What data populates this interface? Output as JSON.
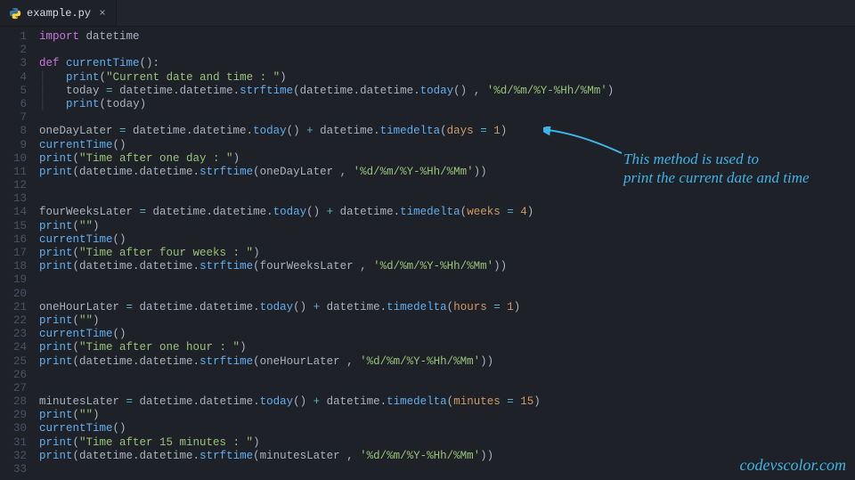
{
  "tab": {
    "filename": "example.py",
    "close_glyph": "×"
  },
  "lines": [
    {
      "n": 1,
      "html": "<span class='kw'>import</span> <span class='mod'>datetime</span>"
    },
    {
      "n": 2,
      "html": ""
    },
    {
      "n": 3,
      "html": "<span class='kw'>def</span> <span class='fn'>currentTime</span><span class='punc'>():</span>"
    },
    {
      "n": 4,
      "html": "<span class='indent-guide'>│</span>   <span class='call'>print</span><span class='punc'>(</span><span class='str'>\"Current date and time : \"</span><span class='punc'>)</span>"
    },
    {
      "n": 5,
      "html": "<span class='indent-guide'>│</span>   <span class='mod'>today </span><span class='op'>=</span><span class='mod'> datetime.datetime.</span><span class='call'>strftime</span><span class='punc'>(</span><span class='mod'>datetime.datetime.</span><span class='call'>today</span><span class='punc'>()</span><span class='mod'> , </span><span class='str'>'%d/%m/%Y-%Hh/%Mm'</span><span class='punc'>)</span>"
    },
    {
      "n": 6,
      "html": "<span class='indent-guide'>│</span>   <span class='call'>print</span><span class='punc'>(</span><span class='mod'>today</span><span class='punc'>)</span>"
    },
    {
      "n": 7,
      "html": ""
    },
    {
      "n": 8,
      "html": "<span class='mod'>oneDayLater </span><span class='op'>=</span><span class='mod'> datetime.datetime.</span><span class='call'>today</span><span class='punc'>()</span><span class='mod'> </span><span class='op'>+</span><span class='mod'> datetime.</span><span class='call'>timedelta</span><span class='punc'>(</span><span class='param'>days</span><span class='mod'> </span><span class='op'>=</span><span class='mod'> </span><span class='num'>1</span><span class='punc'>)</span>"
    },
    {
      "n": 9,
      "html": "<span class='call'>currentTime</span><span class='punc'>()</span>"
    },
    {
      "n": 10,
      "html": "<span class='call'>print</span><span class='punc'>(</span><span class='str'>\"Time after one day : \"</span><span class='punc'>)</span>"
    },
    {
      "n": 11,
      "html": "<span class='call'>print</span><span class='punc'>(</span><span class='mod'>datetime.datetime.</span><span class='call'>strftime</span><span class='punc'>(</span><span class='mod'>oneDayLater , </span><span class='str'>'%d/%m/%Y-%Hh/%Mm'</span><span class='punc'>))</span>"
    },
    {
      "n": 12,
      "html": ""
    },
    {
      "n": 13,
      "html": ""
    },
    {
      "n": 14,
      "html": "<span class='mod'>fourWeeksLater </span><span class='op'>=</span><span class='mod'> datetime.datetime.</span><span class='call'>today</span><span class='punc'>()</span><span class='mod'> </span><span class='op'>+</span><span class='mod'> datetime.</span><span class='call'>timedelta</span><span class='punc'>(</span><span class='param'>weeks</span><span class='mod'> </span><span class='op'>=</span><span class='mod'> </span><span class='num'>4</span><span class='punc'>)</span>"
    },
    {
      "n": 15,
      "html": "<span class='call'>print</span><span class='punc'>(</span><span class='str'>\"\"</span><span class='punc'>)</span>"
    },
    {
      "n": 16,
      "html": "<span class='call'>currentTime</span><span class='punc'>()</span>"
    },
    {
      "n": 17,
      "html": "<span class='call'>print</span><span class='punc'>(</span><span class='str'>\"Time after four weeks : \"</span><span class='punc'>)</span>"
    },
    {
      "n": 18,
      "html": "<span class='call'>print</span><span class='punc'>(</span><span class='mod'>datetime.datetime.</span><span class='call'>strftime</span><span class='punc'>(</span><span class='mod'>fourWeeksLater , </span><span class='str'>'%d/%m/%Y-%Hh/%Mm'</span><span class='punc'>))</span>"
    },
    {
      "n": 19,
      "html": ""
    },
    {
      "n": 20,
      "html": ""
    },
    {
      "n": 21,
      "html": "<span class='mod'>oneHourLater </span><span class='op'>=</span><span class='mod'> datetime.datetime.</span><span class='call'>today</span><span class='punc'>()</span><span class='mod'> </span><span class='op'>+</span><span class='mod'> datetime.</span><span class='call'>timedelta</span><span class='punc'>(</span><span class='param'>hours</span><span class='mod'> </span><span class='op'>=</span><span class='mod'> </span><span class='num'>1</span><span class='punc'>)</span>"
    },
    {
      "n": 22,
      "html": "<span class='call'>print</span><span class='punc'>(</span><span class='str'>\"\"</span><span class='punc'>)</span>"
    },
    {
      "n": 23,
      "html": "<span class='call'>currentTime</span><span class='punc'>()</span>"
    },
    {
      "n": 24,
      "html": "<span class='call'>print</span><span class='punc'>(</span><span class='str'>\"Time after one hour : \"</span><span class='punc'>)</span>"
    },
    {
      "n": 25,
      "html": "<span class='call'>print</span><span class='punc'>(</span><span class='mod'>datetime.datetime.</span><span class='call'>strftime</span><span class='punc'>(</span><span class='mod'>oneHourLater , </span><span class='str'>'%d/%m/%Y-%Hh/%Mm'</span><span class='punc'>))</span>"
    },
    {
      "n": 26,
      "html": ""
    },
    {
      "n": 27,
      "html": ""
    },
    {
      "n": 28,
      "html": "<span class='mod'>minutesLater </span><span class='op'>=</span><span class='mod'> datetime.datetime.</span><span class='call'>today</span><span class='punc'>()</span><span class='mod'> </span><span class='op'>+</span><span class='mod'> datetime.</span><span class='call'>timedelta</span><span class='punc'>(</span><span class='param'>minutes</span><span class='mod'> </span><span class='op'>=</span><span class='mod'> </span><span class='num'>15</span><span class='punc'>)</span>"
    },
    {
      "n": 29,
      "html": "<span class='call'>print</span><span class='punc'>(</span><span class='str'>\"\"</span><span class='punc'>)</span>"
    },
    {
      "n": 30,
      "html": "<span class='call'>currentTime</span><span class='punc'>()</span>"
    },
    {
      "n": 31,
      "html": "<span class='call'>print</span><span class='punc'>(</span><span class='str'>\"Time after 15 minutes : \"</span><span class='punc'>)</span>"
    },
    {
      "n": 32,
      "html": "<span class='call'>print</span><span class='punc'>(</span><span class='mod'>datetime.datetime.</span><span class='call'>strftime</span><span class='punc'>(</span><span class='mod'>minutesLater , </span><span class='str'>'%d/%m/%Y-%Hh/%Mm'</span><span class='punc'>))</span>"
    },
    {
      "n": 33,
      "html": ""
    }
  ],
  "annotation": {
    "note_line1": "This method is used to",
    "note_line2": "print the current date and time"
  },
  "watermark": "codevscolor.com"
}
